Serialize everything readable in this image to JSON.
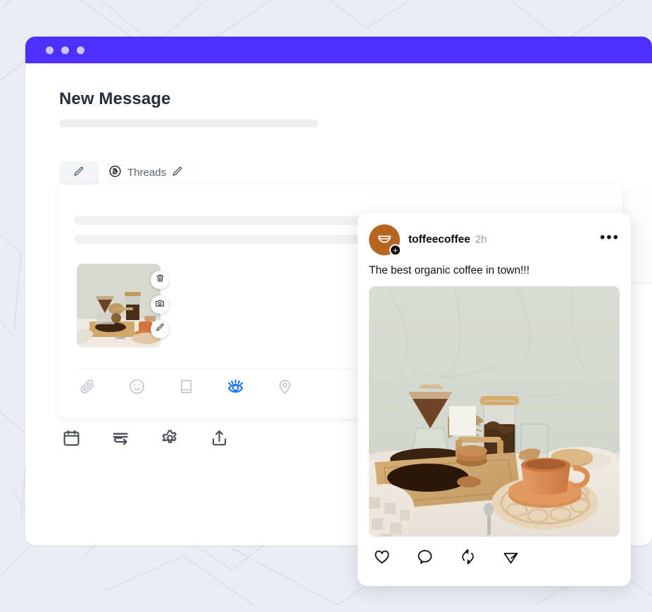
{
  "window": {
    "titlebar_dots": 3,
    "accent_color": "#4d30fb"
  },
  "header": {
    "page_title": "New Message"
  },
  "tabs": [
    {
      "id": "tab-compose",
      "label": "",
      "icon": "pencil-icon",
      "active": false
    },
    {
      "id": "tab-threads",
      "label": "Threads",
      "icon": "threads-logo-icon",
      "trailing_icon": "pencil-icon",
      "active": true
    }
  ],
  "composer": {
    "thumbnail_buttons": [
      {
        "name": "delete-media-button",
        "icon": "trash-icon"
      },
      {
        "name": "replace-media-button",
        "icon": "camera-icon"
      },
      {
        "name": "edit-media-button",
        "icon": "pencil-icon"
      }
    ],
    "tools": [
      {
        "name": "attach-file-button",
        "icon": "paperclip-icon",
        "active": false
      },
      {
        "name": "emoji-button",
        "icon": "smiley-icon",
        "active": false
      },
      {
        "name": "saved-replies-button",
        "icon": "book-icon",
        "active": false
      },
      {
        "name": "preview-button",
        "icon": "eye-icon",
        "active": true
      },
      {
        "name": "location-button",
        "icon": "location-pin-icon",
        "active": false
      }
    ],
    "active_tool_color": "#1877f2"
  },
  "action_bar": [
    {
      "name": "schedule-button",
      "icon": "calendar-icon"
    },
    {
      "name": "queue-button",
      "icon": "queue-arrow-icon"
    },
    {
      "name": "settings-button",
      "icon": "gear-icon"
    },
    {
      "name": "publish-button",
      "icon": "upload-icon"
    }
  ],
  "preview_post": {
    "username": "toffeecoffee",
    "timestamp": "2h",
    "more_label": "•••",
    "caption": "The best organic coffee in town!!!",
    "avatar": {
      "background_color": "#b5651f",
      "logo": "coffee-cup-icon",
      "badge": "+"
    },
    "image_alt": "Pour-over coffee setup on a wooden tray with glass jar of beans and terracotta cup",
    "actions": [
      {
        "name": "like-button",
        "icon": "heart-icon"
      },
      {
        "name": "comment-button",
        "icon": "comment-bubble-icon"
      },
      {
        "name": "repost-button",
        "icon": "repost-icon"
      },
      {
        "name": "share-button",
        "icon": "send-icon"
      }
    ]
  }
}
